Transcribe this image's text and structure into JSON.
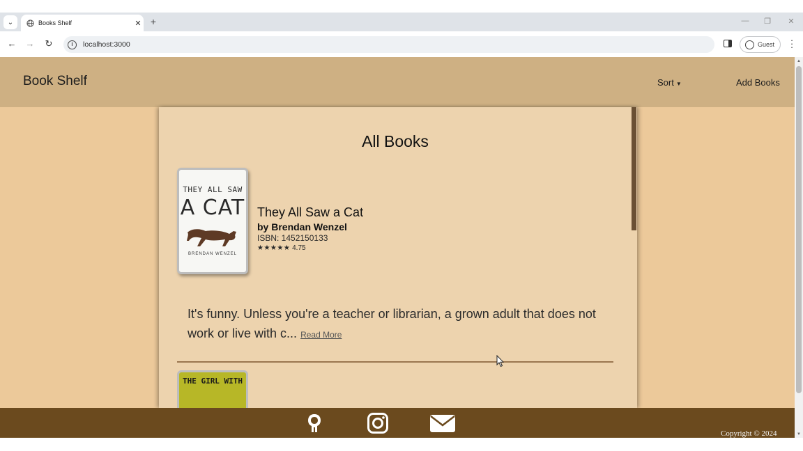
{
  "browser": {
    "tab_title": "Books Shelf",
    "new_tab_symbol": "+",
    "url": "localhost:3000",
    "profile_label": "Guest",
    "icons": [
      "tab-list-icon",
      "globe-icon",
      "close-icon",
      "back-icon",
      "forward-icon",
      "reload-icon",
      "info-icon",
      "side-panel-icon",
      "profile-icon",
      "menu-icon",
      "minimize-icon",
      "restore-icon",
      "window-close-icon"
    ]
  },
  "header": {
    "brand": "Book Shelf",
    "sort_label": "Sort",
    "sort_caret": "▼",
    "add_label": "Add Books",
    "background": "#ceb083"
  },
  "main": {
    "heading": "All Books",
    "books": [
      {
        "cover_line1": "THEY ALL SAW",
        "cover_line2": "A CAT",
        "cover_author": "BRENDAN WENZEL",
        "title": "They All Saw a Cat",
        "author": "by Brendan Wenzel",
        "isbn": "ISBN: 1452150133",
        "stars": "★★★★★",
        "rating": "4.75",
        "description": "It's funny. Unless you're a teacher or librarian, a grown adult that does not work or live with c...",
        "read_more": "Read More"
      },
      {
        "cover_text": "THE GIRL WITH"
      }
    ]
  },
  "footer": {
    "icons": [
      "github-icon",
      "instagram-icon",
      "mail-icon"
    ],
    "copyright": "Copyright © 2024",
    "background": "#6b4a1e"
  },
  "colors": {
    "page_background": "#ecc99a",
    "panel_background": "#edd3ae",
    "divider": "#9a7650"
  }
}
